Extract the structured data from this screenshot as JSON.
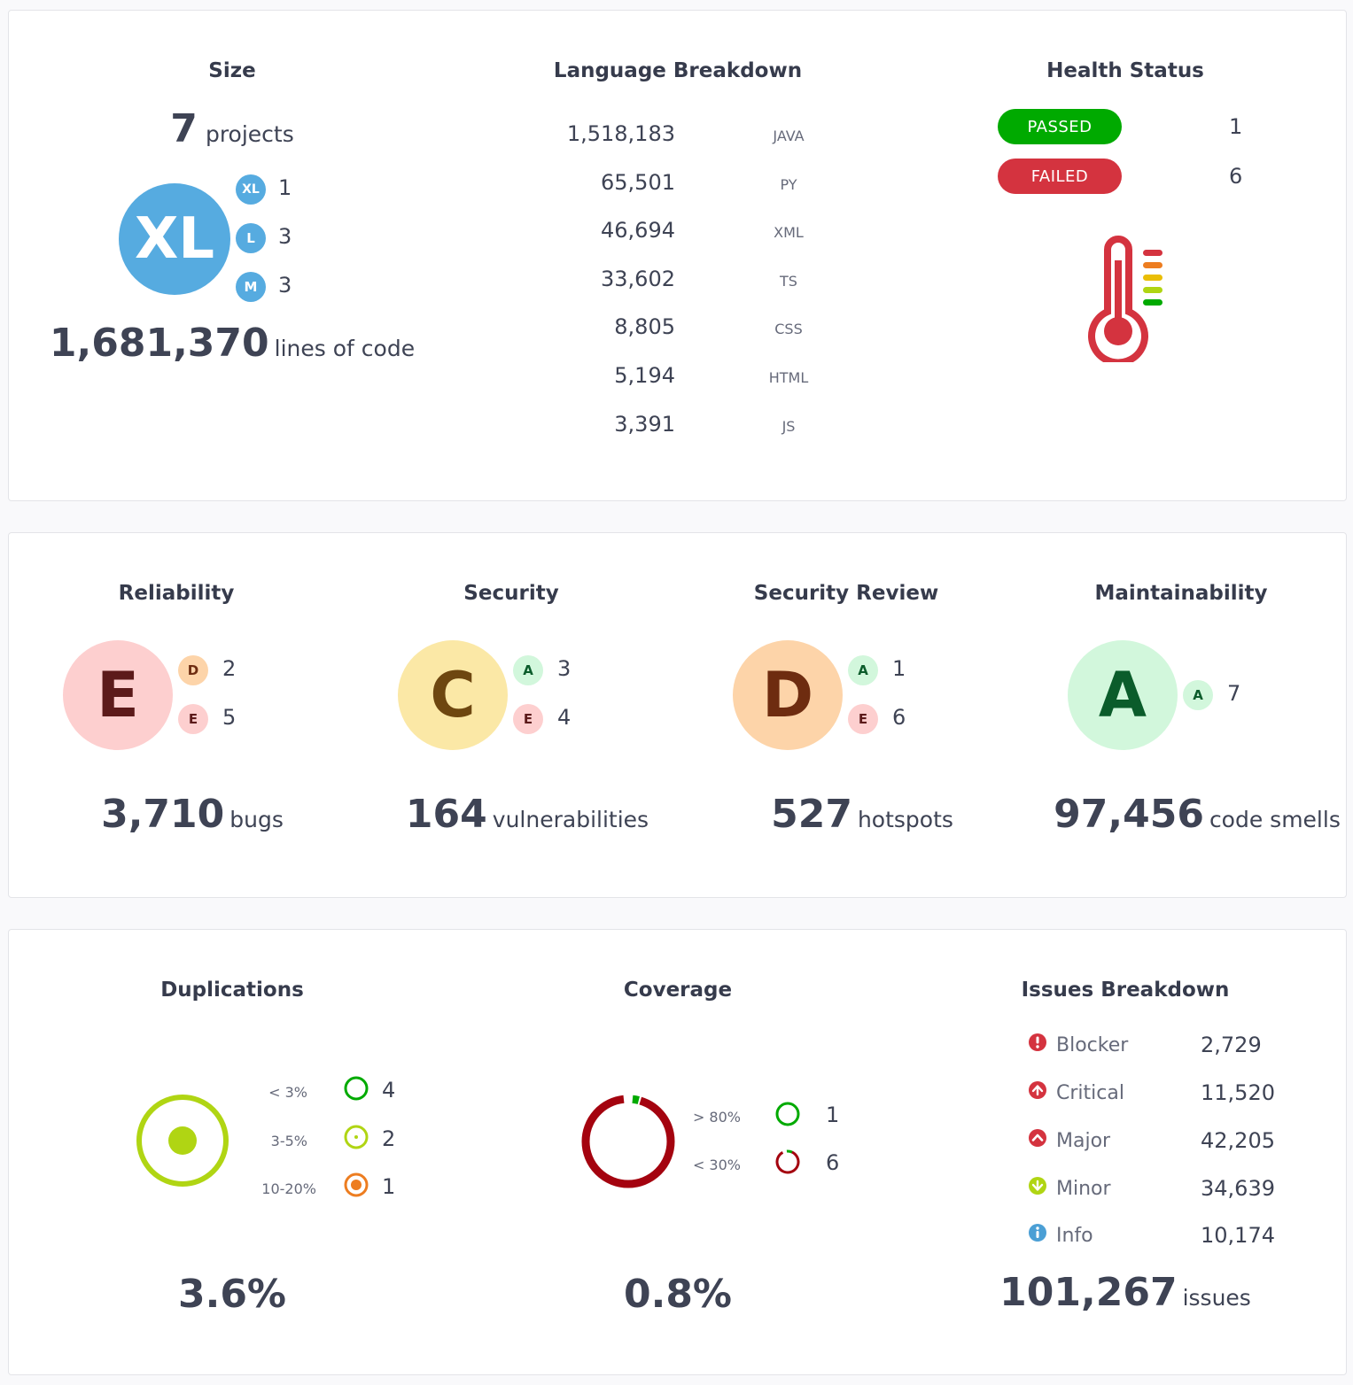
{
  "size": {
    "title": "Size",
    "projects_count": "7",
    "projects_label": "projects",
    "main_badge": "XL",
    "breakdown": [
      {
        "badge": "XL",
        "count": "1"
      },
      {
        "badge": "L",
        "count": "3"
      },
      {
        "badge": "M",
        "count": "3"
      }
    ],
    "loc_value": "1,681,370",
    "loc_label": "lines of code"
  },
  "languages": {
    "title": "Language Breakdown",
    "items": [
      {
        "value": "1,518,183",
        "name": "JAVA"
      },
      {
        "value": "65,501",
        "name": "PY"
      },
      {
        "value": "46,694",
        "name": "XML"
      },
      {
        "value": "33,602",
        "name": "TS"
      },
      {
        "value": "8,805",
        "name": "CSS"
      },
      {
        "value": "5,194",
        "name": "HTML"
      },
      {
        "value": "3,391",
        "name": "JS"
      }
    ]
  },
  "health": {
    "title": "Health Status",
    "passed_label": "PASSED",
    "passed_count": "1",
    "failed_label": "FAILED",
    "failed_count": "6",
    "passed_color": "#00aa00",
    "failed_color": "#d4333f",
    "icon": "thermometer-icon"
  },
  "ratings": {
    "reliability": {
      "title": "Reliability",
      "grade": "E",
      "breakdown": [
        {
          "badge": "D",
          "count": "2"
        },
        {
          "badge": "E",
          "count": "5"
        }
      ],
      "value": "3,710",
      "unit": "bugs"
    },
    "security": {
      "title": "Security",
      "grade": "C",
      "breakdown": [
        {
          "badge": "A",
          "count": "3"
        },
        {
          "badge": "E",
          "count": "4"
        }
      ],
      "value": "164",
      "unit": "vulnerabilities"
    },
    "security_review": {
      "title": "Security Review",
      "grade": "D",
      "breakdown": [
        {
          "badge": "A",
          "count": "1"
        },
        {
          "badge": "E",
          "count": "6"
        }
      ],
      "value": "527",
      "unit": "hotspots"
    },
    "maintainability": {
      "title": "Maintainability",
      "grade": "A",
      "breakdown": [
        {
          "badge": "A",
          "count": "7"
        }
      ],
      "value": "97,456",
      "unit": "code smells"
    },
    "grade_colors": {
      "A": {
        "bg": "#d2f7dc",
        "fg": "#0b5c2b"
      },
      "C": {
        "bg": "#fbe8a6",
        "fg": "#6e4710"
      },
      "D": {
        "bg": "#fdd4a9",
        "fg": "#6e2c10"
      },
      "E": {
        "bg": "#fdcfcf",
        "fg": "#5c1a1a"
      }
    }
  },
  "duplications": {
    "title": "Duplications",
    "items": [
      {
        "range": "< 3%",
        "count": "4"
      },
      {
        "range": "3-5%",
        "count": "2"
      },
      {
        "range": "10-20%",
        "count": "1"
      }
    ],
    "value": "3.6%"
  },
  "coverage": {
    "title": "Coverage",
    "items": [
      {
        "range": "> 80%",
        "count": "1"
      },
      {
        "range": "< 30%",
        "count": "6"
      }
    ],
    "value": "0.8%"
  },
  "issues": {
    "title": "Issues Breakdown",
    "items": [
      {
        "label": "Blocker",
        "value": "2,729",
        "icon": "blocker-icon"
      },
      {
        "label": "Critical",
        "value": "11,520",
        "icon": "critical-icon"
      },
      {
        "label": "Major",
        "value": "42,205",
        "icon": "major-icon"
      },
      {
        "label": "Minor",
        "value": "34,639",
        "icon": "minor-icon"
      },
      {
        "label": "Info",
        "value": "10,174",
        "icon": "info-icon"
      }
    ],
    "total_value": "101,267",
    "total_label": "issues"
  }
}
